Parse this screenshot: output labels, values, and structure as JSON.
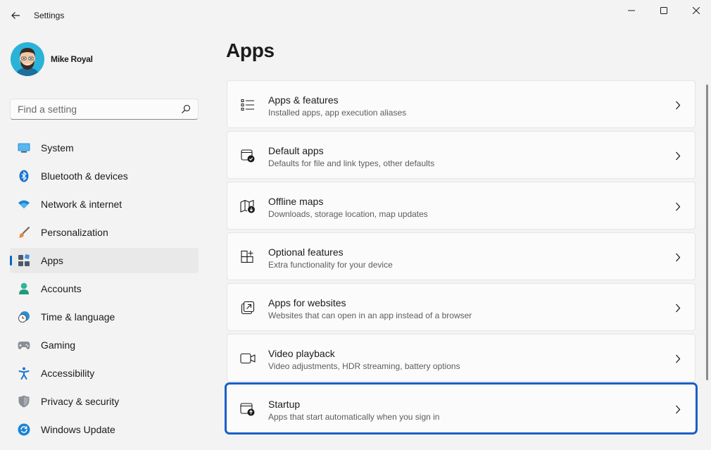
{
  "window": {
    "title": "Settings"
  },
  "profile": {
    "name": "Mike Royal"
  },
  "search": {
    "placeholder": "Find a setting"
  },
  "sidebar": {
    "items": [
      {
        "label": "System",
        "icon": "monitor-icon",
        "active": false
      },
      {
        "label": "Bluetooth & devices",
        "icon": "bluetooth-icon",
        "active": false
      },
      {
        "label": "Network & internet",
        "icon": "wifi-icon",
        "active": false
      },
      {
        "label": "Personalization",
        "icon": "brush-icon",
        "active": false
      },
      {
        "label": "Apps",
        "icon": "apps-icon",
        "active": true
      },
      {
        "label": "Accounts",
        "icon": "person-icon",
        "active": false
      },
      {
        "label": "Time & language",
        "icon": "clock-globe-icon",
        "active": false
      },
      {
        "label": "Gaming",
        "icon": "gamepad-icon",
        "active": false
      },
      {
        "label": "Accessibility",
        "icon": "accessibility-icon",
        "active": false
      },
      {
        "label": "Privacy & security",
        "icon": "shield-icon",
        "active": false
      },
      {
        "label": "Windows Update",
        "icon": "update-icon",
        "active": false
      }
    ]
  },
  "main": {
    "title": "Apps",
    "items": [
      {
        "title": "Apps & features",
        "description": "Installed apps, app execution aliases",
        "icon": "list-icon"
      },
      {
        "title": "Default apps",
        "description": "Defaults for file and link types, other defaults",
        "icon": "default-apps-icon"
      },
      {
        "title": "Offline maps",
        "description": "Downloads, storage location, map updates",
        "icon": "map-download-icon"
      },
      {
        "title": "Optional features",
        "description": "Extra functionality for your device",
        "icon": "add-grid-icon"
      },
      {
        "title": "Apps for websites",
        "description": "Websites that can open in an app instead of a browser",
        "icon": "open-external-icon"
      },
      {
        "title": "Video playback",
        "description": "Video adjustments, HDR streaming, battery options",
        "icon": "video-camera-icon"
      },
      {
        "title": "Startup",
        "description": "Apps that start automatically when you sign in",
        "icon": "startup-icon",
        "focused": true
      }
    ]
  },
  "colors": {
    "accent": "#0067c0",
    "focus_outline": "#1a5fc7",
    "background": "#f3f3f3",
    "card": "#fbfbfb"
  }
}
